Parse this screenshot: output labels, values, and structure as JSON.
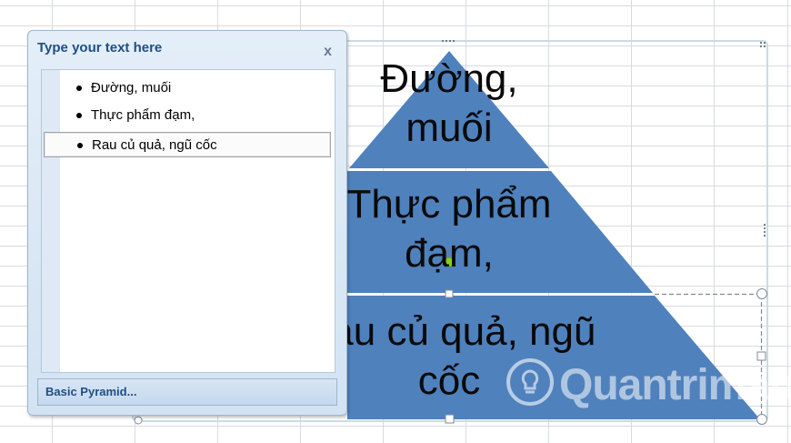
{
  "text_pane": {
    "title": "Type your text here",
    "close_glyph": "x",
    "items": [
      {
        "label": "Đường, muối"
      },
      {
        "label": "Thực phẩm đạm,"
      },
      {
        "label": "Rau củ quả, ngũ cốc",
        "selected": true
      }
    ],
    "footer_label": "Basic Pyramid..."
  },
  "pyramid": {
    "fill_color": "#4f81bd",
    "levels": [
      {
        "line1": "Đường,",
        "line2": "muối"
      },
      {
        "line1": "Thực phẩm",
        "line2": "đạm,"
      },
      {
        "line1": "Rau củ quả, ngũ",
        "line2": "cốc"
      }
    ]
  },
  "watermark": {
    "text": "Quantrimang"
  },
  "colors": {
    "grid": "#d6dbe1",
    "accent": "#1f4e86"
  }
}
